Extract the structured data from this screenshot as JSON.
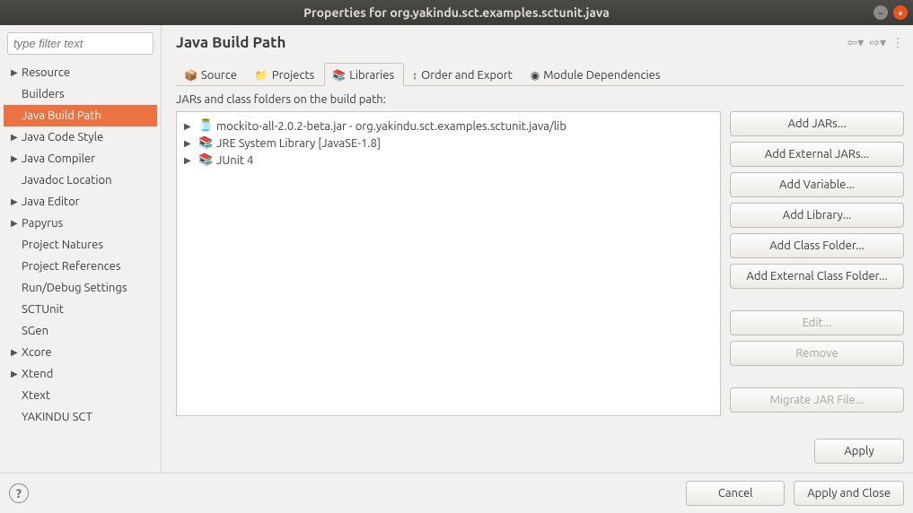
{
  "window": {
    "title": "Properties for org.yakindu.sct.examples.sctunit.java"
  },
  "sidebar": {
    "filter_placeholder": "type filter text",
    "items": [
      {
        "label": "Resource",
        "expandable": true
      },
      {
        "label": "Builders",
        "expandable": false
      },
      {
        "label": "Java Build Path",
        "expandable": false,
        "selected": true
      },
      {
        "label": "Java Code Style",
        "expandable": true
      },
      {
        "label": "Java Compiler",
        "expandable": true
      },
      {
        "label": "Javadoc Location",
        "expandable": false
      },
      {
        "label": "Java Editor",
        "expandable": true
      },
      {
        "label": "Papyrus",
        "expandable": true
      },
      {
        "label": "Project Natures",
        "expandable": false
      },
      {
        "label": "Project References",
        "expandable": false
      },
      {
        "label": "Run/Debug Settings",
        "expandable": false
      },
      {
        "label": "SCTUnit",
        "expandable": false
      },
      {
        "label": "SGen",
        "expandable": false
      },
      {
        "label": "Xcore",
        "expandable": true
      },
      {
        "label": "Xtend",
        "expandable": true
      },
      {
        "label": "Xtext",
        "expandable": false
      },
      {
        "label": "YAKINDU SCT",
        "expandable": false
      }
    ]
  },
  "header": {
    "title": "Java Build Path"
  },
  "tabs": [
    {
      "label": "Source",
      "icon": "📦",
      "active": false
    },
    {
      "label": "Projects",
      "icon": "📁",
      "active": false
    },
    {
      "label": "Libraries",
      "icon": "📚",
      "active": true
    },
    {
      "label": "Order and Export",
      "icon": "↕",
      "active": false
    },
    {
      "label": "Module Dependencies",
      "icon": "◉",
      "active": false
    }
  ],
  "libraries": {
    "subhead": "JARs and class folders on the build path:",
    "tree": [
      {
        "label": "mockito-all-2.0.2-beta.jar - org.yakindu.sct.examples.sctunit.java/lib",
        "icon": "jar"
      },
      {
        "label": "JRE System Library [JavaSE-1.8]",
        "icon": "lib"
      },
      {
        "label": "JUnit 4",
        "icon": "lib"
      }
    ],
    "buttons": {
      "add_jars": "Add JARs...",
      "add_external_jars": "Add External JARs...",
      "add_variable": "Add Variable...",
      "add_library": "Add Library...",
      "add_class_folder": "Add Class Folder...",
      "add_external_class_folder": "Add External Class Folder...",
      "edit": "Edit...",
      "remove": "Remove",
      "migrate": "Migrate JAR File..."
    }
  },
  "footer": {
    "apply": "Apply",
    "cancel": "Cancel",
    "apply_close": "Apply and Close"
  }
}
